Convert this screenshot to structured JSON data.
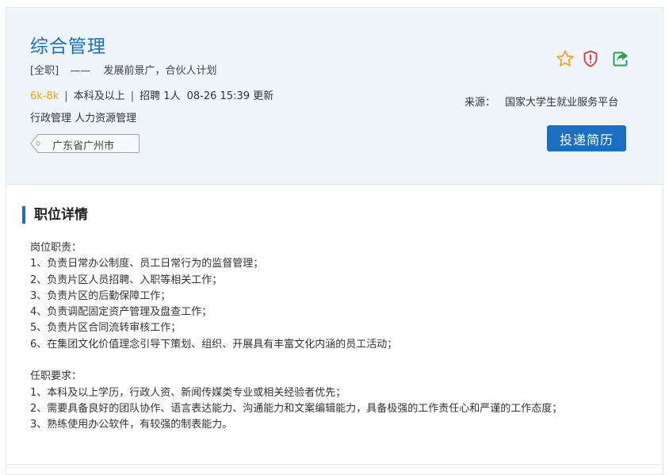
{
  "job": {
    "title": "综合管理",
    "type_tag": "[全职]",
    "separator": "——",
    "slogan": "发展前景广，合伙人计划",
    "salary": "6k-8k",
    "pipe": "|",
    "education": "本科及以上",
    "recruit": "招聘 1人",
    "updated": "08-26 15:39 更新",
    "category": "行政管理 人力资源管理",
    "location": "广东省广州市"
  },
  "actions": {
    "favorite_icon": "star-icon",
    "report_icon": "shield-alert-icon",
    "share_icon": "share-icon",
    "colors": {
      "star": "#f5a623",
      "report": "#e53935",
      "share": "#2e9e4f"
    }
  },
  "source": {
    "label": "来源：",
    "name": "国家大学生就业服务平台"
  },
  "apply_button": {
    "label": "投递简历",
    "color": "#1a6fc2"
  },
  "details": {
    "section_title": "职位详情",
    "duties_heading": "岗位职责：",
    "duties": [
      "1、负责日常办公制度、员工日常行为的监督管理；",
      "2、负责片区人员招聘、入职等相关工作；",
      "3、负责片区的后勤保障工作；",
      "4、负责调配固定资产管理及盘查工作；",
      "5、负责片区合同流转审核工作；",
      "6、在集团文化价值理念引导下策划、组织、开展具有丰富文化内涵的员工活动；"
    ],
    "requirements_heading": "任职要求：",
    "requirements": [
      "1、本科及以上学历，行政人资、新闻传媒类专业或相关经验者优先；",
      "2、需要具备良好的团队协作、语言表达能力、沟通能力和文案编辑能力，具备极强的工作责任心和严谨的工作态度；",
      "3、熟练使用办公软件，有较强的制表能力。"
    ]
  }
}
